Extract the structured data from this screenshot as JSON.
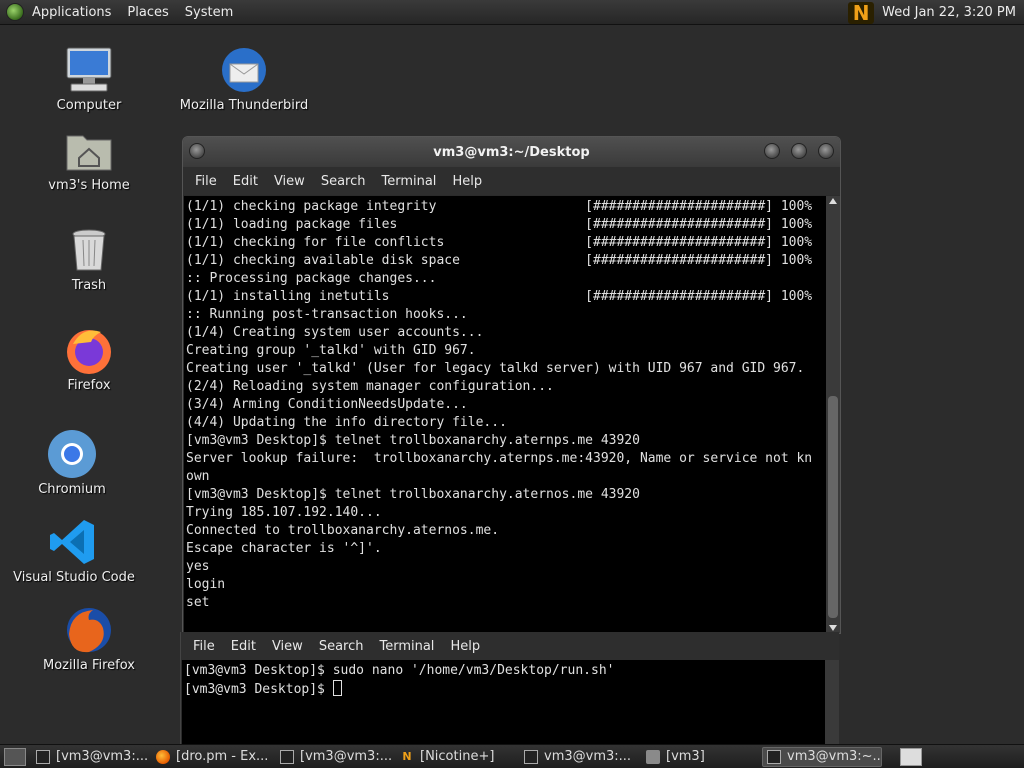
{
  "top_panel": {
    "menu": [
      "Applications",
      "Places",
      "System"
    ],
    "clock": "Wed Jan 22,  3:20 PM"
  },
  "desktop_icons": [
    {
      "label": "Computer",
      "icon": "computer-icon"
    },
    {
      "label": "vm3's Home",
      "icon": "home-folder-icon"
    },
    {
      "label": "Trash",
      "icon": "trash-icon"
    },
    {
      "label": "Firefox",
      "icon": "firefox-icon"
    },
    {
      "label": "Chromium",
      "icon": "chromium-icon"
    },
    {
      "label": "Visual Studio Code",
      "icon": "vscode-icon"
    },
    {
      "label": "Mozilla Firefox",
      "icon": "mozilla-firefox-icon"
    },
    {
      "label": "Mozilla Thunderbird",
      "icon": "thunderbird-icon"
    }
  ],
  "terminal": {
    "title": "vm3@vm3:~/Desktop",
    "menu": [
      "File",
      "Edit",
      "View",
      "Search",
      "Terminal",
      "Help"
    ],
    "lines": [
      "(1/1) checking package integrity                   [######################] 100%",
      "(1/1) loading package files                        [######################] 100%",
      "(1/1) checking for file conflicts                  [######################] 100%",
      "(1/1) checking available disk space                [######################] 100%",
      ":: Processing package changes...",
      "(1/1) installing inetutils                         [######################] 100%",
      ":: Running post-transaction hooks...",
      "(1/4) Creating system user accounts...",
      "Creating group '_talkd' with GID 967.",
      "Creating user '_talkd' (User for legacy talkd server) with UID 967 and GID 967.",
      "(2/4) Reloading system manager configuration...",
      "(3/4) Arming ConditionNeedsUpdate...",
      "(4/4) Updating the info directory file...",
      "[vm3@vm3 Desktop]$ telnet trollboxanarchy.aternps.me 43920",
      "Server lookup failure:  trollboxanarchy.aternps.me:43920, Name or service not kn",
      "own",
      "[vm3@vm3 Desktop]$ telnet trollboxanarchy.aternos.me 43920",
      "Trying 185.107.192.140...",
      "Connected to trollboxanarchy.aternos.me.",
      "Escape character is '^]'.",
      "yes",
      "login",
      "set"
    ]
  },
  "terminal2": {
    "menu": [
      "File",
      "Edit",
      "View",
      "Search",
      "Terminal",
      "Help"
    ],
    "lines": [
      "[vm3@vm3 Desktop]$ sudo nano '/home/vm3/Desktop/run.sh'",
      "[vm3@vm3 Desktop]$ "
    ]
  },
  "taskbar": {
    "tasks": [
      {
        "label": "[vm3@vm3:...",
        "icon": "terminal-icon",
        "active": false
      },
      {
        "label": "[dro.pm - Ex...",
        "icon": "firefox-icon",
        "active": false
      },
      {
        "label": "[vm3@vm3:...",
        "icon": "terminal-icon",
        "active": false
      },
      {
        "label": "[Nicotine+]",
        "icon": "nicotine-icon",
        "active": false
      },
      {
        "label": "vm3@vm3:...",
        "icon": "terminal-icon",
        "active": false
      },
      {
        "label": "[vm3]",
        "icon": "folder-icon",
        "active": false
      },
      {
        "label": "vm3@vm3:~...",
        "icon": "terminal-icon",
        "active": true
      }
    ]
  }
}
